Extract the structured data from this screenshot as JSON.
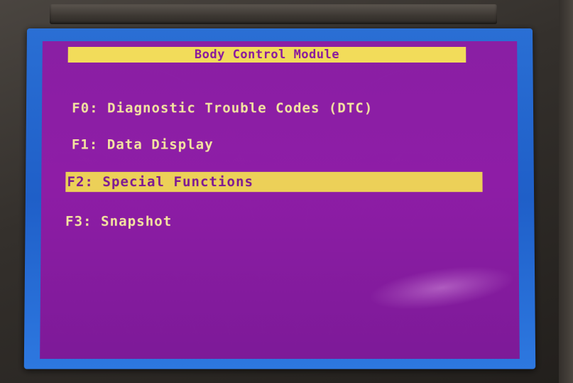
{
  "screen": {
    "title": "Body Control Module",
    "menu": [
      {
        "label": "F0: Diagnostic Trouble Codes (DTC)",
        "selected": false
      },
      {
        "label": "F1: Data Display",
        "selected": false
      },
      {
        "label": "F2: Special Functions",
        "selected": true
      },
      {
        "label": "F3: Snapshot",
        "selected": false
      }
    ]
  },
  "colors": {
    "screen_background": "#8a1fa4",
    "highlight": "#ecd058",
    "text": "#f4e4a0",
    "bezel": "#2a6fd4"
  }
}
